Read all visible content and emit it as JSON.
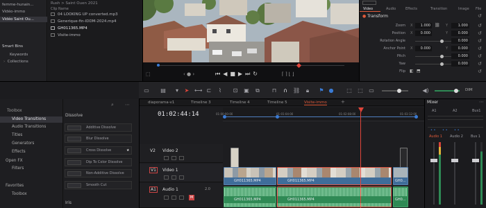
{
  "media_pool": {
    "path": "Rush > Saint Ouen 2021",
    "bins": [
      {
        "label": "femme-hunain..."
      },
      {
        "label": "Vidéo-immo"
      },
      {
        "label": "Vidéo Saint Ou..."
      }
    ],
    "smart_bins_title": "Smart Bins",
    "smart_bins": [
      {
        "label": "Keywords"
      },
      {
        "label": "Collections"
      }
    ],
    "clip_header": "Clip Name",
    "clips": [
      {
        "name": "04 LOOKING UP converted.mp3",
        "type": "audio"
      },
      {
        "name": "Generique-fin-IDDM-2024.mp4",
        "type": "video"
      },
      {
        "name": "GH011365.MP4",
        "type": "video"
      },
      {
        "name": "Visite-immo",
        "type": "timeline"
      }
    ]
  },
  "inspector": {
    "tabs": [
      "Video",
      "Audio",
      "Effects",
      "Transition",
      "Image",
      "File"
    ],
    "section": "Transform",
    "rows": [
      {
        "label": "Zoom",
        "x": "1.000",
        "y": "1.000"
      },
      {
        "label": "Position",
        "x": "0.000",
        "y": "0.000"
      },
      {
        "label": "Rotation Angle",
        "x": "0.000"
      },
      {
        "label": "Anchor Point",
        "x": "0.000",
        "y": "0.000"
      },
      {
        "label": "Pitch",
        "x": "0.000"
      },
      {
        "label": "Yaw",
        "x": "0.000"
      },
      {
        "label": "Flip"
      }
    ],
    "x_axis": "X",
    "y_axis": "Y"
  },
  "effects": {
    "sections": [
      {
        "label": "Toolbox"
      },
      {
        "label": "Video Transitions"
      },
      {
        "label": "Audio Transitions"
      },
      {
        "label": "Titles"
      },
      {
        "label": "Generators"
      },
      {
        "label": "Effects"
      },
      {
        "label": "Open FX"
      },
      {
        "label": "Filters"
      },
      {
        "label": "Audio FX"
      },
      {
        "label": "Fairlight FX"
      }
    ],
    "favorites_title": "Favorites",
    "favorites": [
      {
        "label": "Toolbox"
      }
    ],
    "category_title": "Dissolve",
    "category_footer": "Iris",
    "transitions": [
      {
        "label": "Additive Dissolve"
      },
      {
        "label": "Blur Dissolve"
      },
      {
        "label": "Cross Dissolve"
      },
      {
        "label": "Dip To Color Dissolve"
      },
      {
        "label": "Non-Additive Dissolve"
      },
      {
        "label": "Smooth Cut"
      }
    ]
  },
  "timeline": {
    "tabs": [
      {
        "label": "diaporama-v1"
      },
      {
        "label": "Timeline 3"
      },
      {
        "label": "Timeline 4"
      },
      {
        "label": "Timeline 5"
      },
      {
        "label": "Visite-immo",
        "active": true
      }
    ],
    "timecode": "01:02:44:14",
    "ticks": [
      "01:00:00:00",
      "01:01:04:00",
      "01:02:08:00",
      "01:03:12:00"
    ],
    "tracks": [
      {
        "id": "V2",
        "name": "Video 2"
      },
      {
        "id": "V1",
        "name": "Video 1"
      },
      {
        "id": "A1",
        "name": "Audio 1",
        "level": "2.0"
      }
    ],
    "clips": {
      "v1_a": "GH011365.MP4",
      "v1_b": "GH011365.MP4",
      "v1_c": "GH0...",
      "a1_a": "GH011365.MP4",
      "a1_b": "GH011365.MP4",
      "a1_c": "GH0..."
    }
  },
  "mixer": {
    "title": "Mixer",
    "channels": [
      "A1",
      "A2",
      "Bus1"
    ],
    "channel_names": [
      "Audio 1",
      "Audio 2",
      "Bus 1"
    ],
    "dim_label": "DIM"
  },
  "colors": {
    "accent": "#e05a3a",
    "playhead": "#e0453a",
    "video_clip": "#3f6d9a",
    "audio_clip": "#2f8a55",
    "blue_ui": "#3a7bd5"
  }
}
